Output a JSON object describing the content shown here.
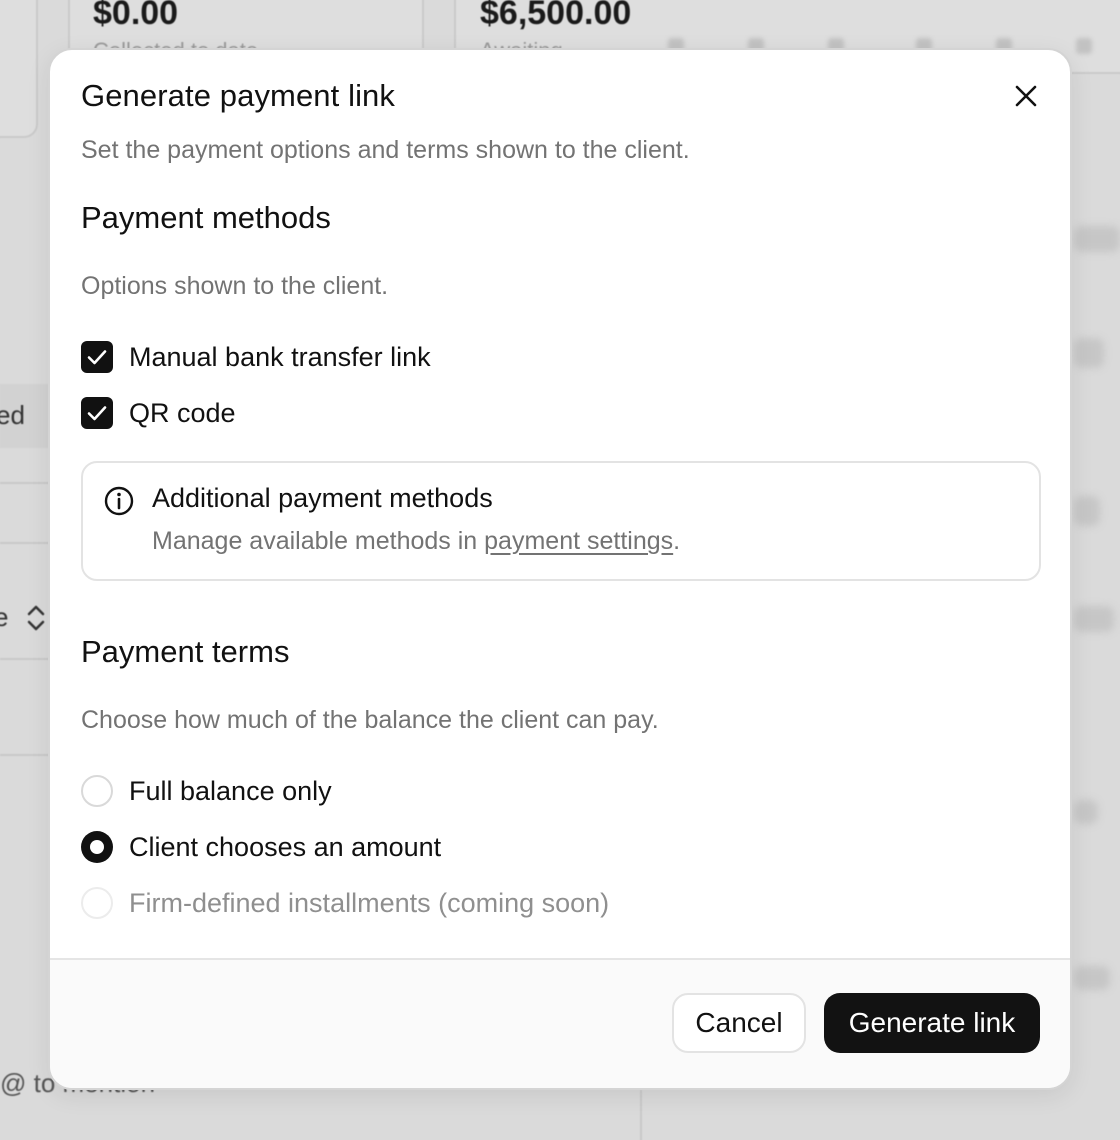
{
  "background": {
    "amount_left": "$0.00",
    "amount_right": "$6,500.00",
    "sub_left": "Collected to date",
    "sub_right": "Awaiting",
    "row_text_1": "ed",
    "row_text_2": "e",
    "mention_hint": "@ to mention"
  },
  "modal": {
    "title": "Generate payment link",
    "subtitle": "Set the payment options and terms shown to the client.",
    "close_icon": "close-icon"
  },
  "payment_methods": {
    "title": "Payment methods",
    "description": "Options shown to the client.",
    "options": [
      {
        "label": "Manual bank transfer link",
        "checked": true
      },
      {
        "label": "QR code",
        "checked": true
      }
    ]
  },
  "info_box": {
    "icon": "info-icon",
    "title": "Additional payment methods",
    "desc_prefix": "Manage available methods in ",
    "link_text": "payment settings",
    "desc_suffix": "."
  },
  "payment_terms": {
    "title": "Payment terms",
    "description": "Choose how much of the balance the client can pay.",
    "options": [
      {
        "label": "Full balance only",
        "selected": false,
        "disabled": false
      },
      {
        "label": "Client chooses an amount",
        "selected": true,
        "disabled": false
      },
      {
        "label": "Firm-defined installments (coming soon)",
        "selected": false,
        "disabled": true
      }
    ]
  },
  "footer": {
    "cancel_label": "Cancel",
    "primary_label": "Generate link"
  },
  "colors": {
    "primary": "#121212",
    "muted_text": "#737373",
    "backdrop": "#dadada"
  }
}
